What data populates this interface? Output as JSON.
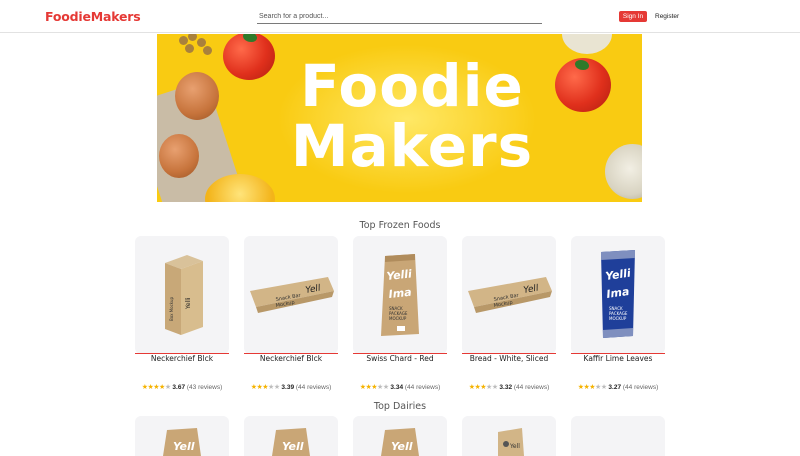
{
  "header": {
    "logo": "FoodieMakers",
    "search_placeholder": "Search for a product...",
    "signin_label": "Sign In",
    "register_label": "Register"
  },
  "hero": {
    "title": "Foodie\nMakers",
    "line1": "Foodie",
    "line2": "Makers"
  },
  "sections": [
    {
      "title": "Top Frozen Foods",
      "products": [
        {
          "name": "Neckerchief Blck",
          "rating": "3.67",
          "reviews": "(43 reviews)",
          "stars": 4,
          "image": "box-mockup"
        },
        {
          "name": "Neckerchief Blck",
          "rating": "3.39",
          "reviews": "(44 reviews)",
          "stars": 3,
          "image": "snack-bar-kraft"
        },
        {
          "name": "Swiss Chard - Red",
          "rating": "3.34",
          "reviews": "(44 reviews)",
          "stars": 3,
          "image": "snack-pack-kraft"
        },
        {
          "name": "Bread - White, Sliced",
          "rating": "3.32",
          "reviews": "(44 reviews)",
          "stars": 3,
          "image": "snack-bar-kraft"
        },
        {
          "name": "Kaffir Lime Leaves",
          "rating": "3.27",
          "reviews": "(44 reviews)",
          "stars": 3,
          "image": "snack-bar-blue"
        }
      ]
    },
    {
      "title": "Top Dairies",
      "products": [
        {
          "image": "kraft-pouch"
        },
        {
          "image": "kraft-pouch"
        },
        {
          "image": "kraft-pouch"
        },
        {
          "image": "kraft-box"
        },
        {
          "image": "empty"
        }
      ]
    }
  ],
  "colors": {
    "brand": "#e53935",
    "banner": "#f9cb12",
    "star": "#f5b301"
  }
}
